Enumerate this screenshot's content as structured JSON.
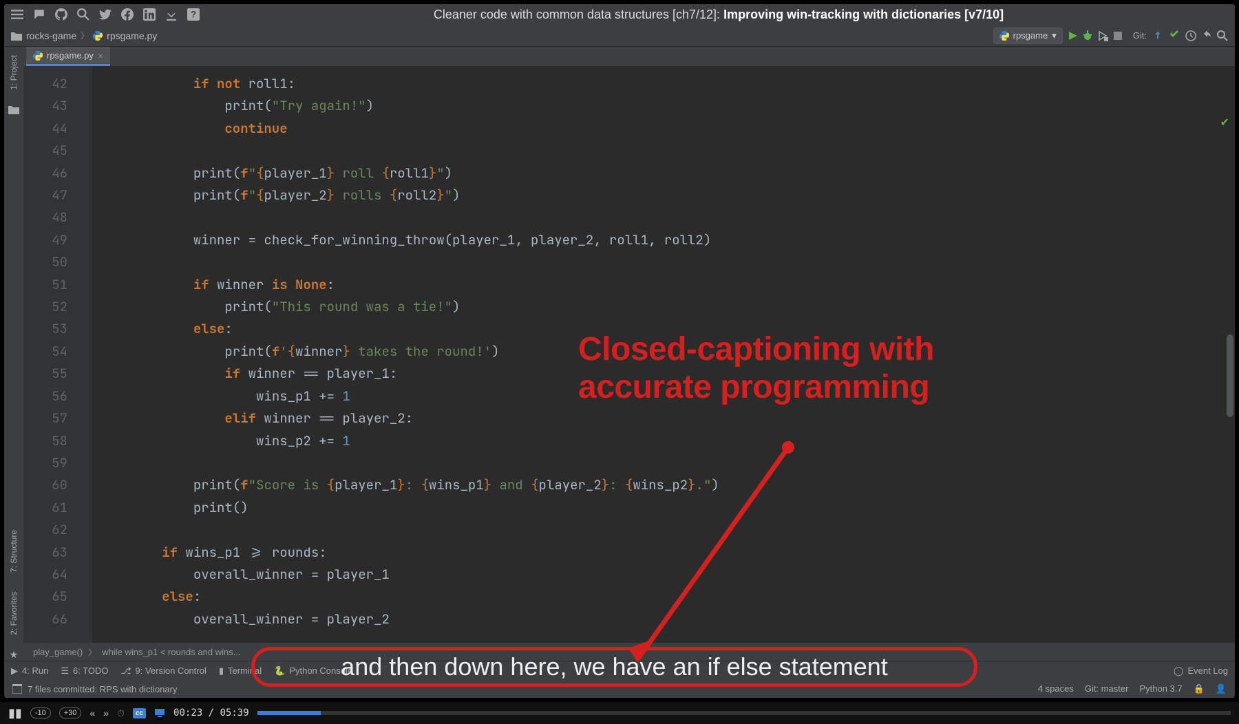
{
  "titlebar": {
    "prefix": "Cleaner code with common data structures [ch7/12]: ",
    "title": "Improving win-tracking with dictionaries [v7/10]"
  },
  "nav": {
    "folder": "rocks-game",
    "file": "rpsgame.py",
    "runconfig": "rpsgame",
    "git_label": "Git:"
  },
  "sidebar": {
    "project": "1: Project",
    "structure": "7: Structure",
    "favorites": "2: Favorites"
  },
  "tab": {
    "name": "rpsgame.py"
  },
  "gutter": {
    "start": 42,
    "end": 66
  },
  "code_lines": [
    {
      "n": 42,
      "i": 12,
      "t": [
        [
          "kw",
          "if"
        ],
        [
          "id",
          " "
        ],
        [
          "kw",
          "not"
        ],
        [
          "id",
          " roll1:"
        ]
      ]
    },
    {
      "n": 43,
      "i": 16,
      "t": [
        [
          "fn",
          "print"
        ],
        [
          "id",
          "("
        ],
        [
          "str",
          "\"Try again!\""
        ],
        [
          "id",
          ")"
        ]
      ]
    },
    {
      "n": 44,
      "i": 16,
      "t": [
        [
          "kw",
          "continue"
        ]
      ]
    },
    {
      "n": 45,
      "i": 0,
      "t": []
    },
    {
      "n": 46,
      "i": 12,
      "t": [
        [
          "fn",
          "print"
        ],
        [
          "id",
          "("
        ],
        [
          "kw",
          "f"
        ],
        [
          "str",
          "\""
        ],
        [
          "tpl",
          "{"
        ],
        [
          "id",
          "player_1"
        ],
        [
          "tpl",
          "}"
        ],
        [
          "str",
          " roll "
        ],
        [
          "tpl",
          "{"
        ],
        [
          "id",
          "roll1"
        ],
        [
          "tpl",
          "}"
        ],
        [
          "str",
          "\""
        ],
        [
          "id",
          ")"
        ]
      ]
    },
    {
      "n": 47,
      "i": 12,
      "t": [
        [
          "fn",
          "print"
        ],
        [
          "id",
          "("
        ],
        [
          "kw",
          "f"
        ],
        [
          "str",
          "\""
        ],
        [
          "tpl",
          "{"
        ],
        [
          "id",
          "player_2"
        ],
        [
          "tpl",
          "}"
        ],
        [
          "str",
          " rolls "
        ],
        [
          "tpl",
          "{"
        ],
        [
          "id",
          "roll2"
        ],
        [
          "tpl",
          "}"
        ],
        [
          "str",
          "\""
        ],
        [
          "id",
          ")"
        ]
      ]
    },
    {
      "n": 48,
      "i": 0,
      "t": []
    },
    {
      "n": 49,
      "i": 12,
      "t": [
        [
          "id",
          "winner = check_for_winning_throw(player_1, player_2, roll1, roll2)"
        ]
      ]
    },
    {
      "n": 50,
      "i": 0,
      "t": []
    },
    {
      "n": 51,
      "i": 12,
      "t": [
        [
          "kw",
          "if"
        ],
        [
          "id",
          " winner "
        ],
        [
          "kw",
          "is"
        ],
        [
          "id",
          " "
        ],
        [
          "kw",
          "None"
        ],
        [
          "id",
          ":"
        ]
      ]
    },
    {
      "n": 52,
      "i": 16,
      "t": [
        [
          "fn",
          "print"
        ],
        [
          "id",
          "("
        ],
        [
          "str",
          "\"This round was a tie!\""
        ],
        [
          "id",
          ")"
        ]
      ]
    },
    {
      "n": 53,
      "i": 12,
      "t": [
        [
          "kw",
          "else"
        ],
        [
          "id",
          ":"
        ]
      ]
    },
    {
      "n": 54,
      "i": 16,
      "t": [
        [
          "fn",
          "print"
        ],
        [
          "id",
          "("
        ],
        [
          "kw",
          "f"
        ],
        [
          "str",
          "'"
        ],
        [
          "tpl",
          "{"
        ],
        [
          "id",
          "winner"
        ],
        [
          "tpl",
          "}"
        ],
        [
          "str",
          " takes the round!'"
        ],
        [
          "id",
          ")"
        ]
      ]
    },
    {
      "n": 55,
      "i": 16,
      "t": [
        [
          "kw",
          "if"
        ],
        [
          "id",
          " winner == player_1:"
        ]
      ]
    },
    {
      "n": 56,
      "i": 20,
      "t": [
        [
          "id",
          "wins_p1 += "
        ],
        [
          "num",
          "1"
        ]
      ]
    },
    {
      "n": 57,
      "i": 16,
      "t": [
        [
          "kw",
          "elif"
        ],
        [
          "id",
          " winner == player_2:"
        ]
      ]
    },
    {
      "n": 58,
      "i": 20,
      "t": [
        [
          "id",
          "wins_p2 += "
        ],
        [
          "num",
          "1"
        ]
      ]
    },
    {
      "n": 59,
      "i": 0,
      "t": []
    },
    {
      "n": 60,
      "i": 12,
      "t": [
        [
          "fn",
          "print"
        ],
        [
          "id",
          "("
        ],
        [
          "kw",
          "f"
        ],
        [
          "str",
          "\"Score is "
        ],
        [
          "tpl",
          "{"
        ],
        [
          "id",
          "player_1"
        ],
        [
          "tpl",
          "}"
        ],
        [
          "str",
          ": "
        ],
        [
          "tpl",
          "{"
        ],
        [
          "id",
          "wins_p1"
        ],
        [
          "tpl",
          "}"
        ],
        [
          "str",
          " and "
        ],
        [
          "tpl",
          "{"
        ],
        [
          "id",
          "player_2"
        ],
        [
          "tpl",
          "}"
        ],
        [
          "str",
          ": "
        ],
        [
          "tpl",
          "{"
        ],
        [
          "id",
          "wins_p2"
        ],
        [
          "tpl",
          "}"
        ],
        [
          "str",
          ".\""
        ],
        [
          "id",
          ")"
        ]
      ]
    },
    {
      "n": 61,
      "i": 12,
      "t": [
        [
          "fn",
          "print"
        ],
        [
          "id",
          "()"
        ]
      ]
    },
    {
      "n": 62,
      "i": 0,
      "t": []
    },
    {
      "n": 63,
      "i": 8,
      "t": [
        [
          "kw",
          "if"
        ],
        [
          "id",
          " wins_p1 >= rounds:"
        ]
      ]
    },
    {
      "n": 64,
      "i": 12,
      "t": [
        [
          "id",
          "overall_winner = player_1"
        ]
      ]
    },
    {
      "n": 65,
      "i": 8,
      "t": [
        [
          "kw",
          "else"
        ],
        [
          "id",
          ":"
        ]
      ]
    },
    {
      "n": 66,
      "i": 12,
      "t": [
        [
          "id",
          "overall_winner = player_2"
        ]
      ]
    }
  ],
  "breadcrumb": {
    "fn": "play_game()",
    "ctx": "while wins_p1 < rounds and wins..."
  },
  "bottom": {
    "run": "4: Run",
    "todo": "6: TODO",
    "vcs": "9: Version Control",
    "terminal": "Terminal",
    "pyconsole": "Python Console",
    "eventlog": "Event Log"
  },
  "status": {
    "commit": "7 files committed: RPS with dictionary",
    "spaces": "4 spaces",
    "git": "Git: master",
    "python": "Python 3.7"
  },
  "annotation": {
    "line1": "Closed-captioning with",
    "line2": "accurate programming"
  },
  "caption": "and then down here, we have an if else statement",
  "video": {
    "jump_back": "-10",
    "jump_fwd": "+30",
    "time_current": "00:23",
    "time_sep": " / ",
    "time_total": "05:39",
    "cc": "cc"
  }
}
